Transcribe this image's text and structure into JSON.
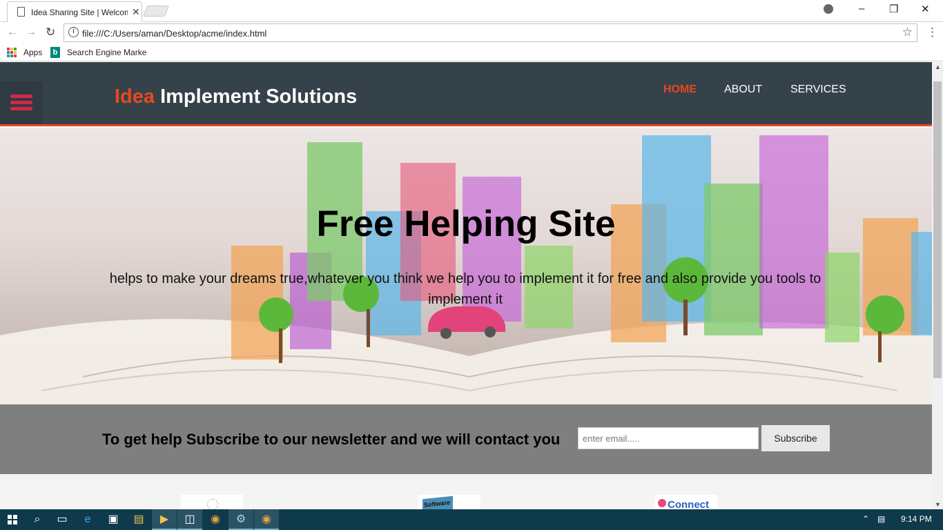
{
  "browser": {
    "tab_title": "Idea Sharing Site | Welcome",
    "tab_close": "✕",
    "url": "file:///C:/Users/aman/Desktop/acme/index.html",
    "bookmarks": [
      {
        "label": "Apps",
        "icon": "apps-grid-icon"
      },
      {
        "label": "Search Engine Marke",
        "icon": "bing-icon"
      }
    ],
    "window_controls": [
      "–",
      "❐",
      "✕"
    ]
  },
  "site": {
    "logo_highlight": "Idea",
    "logo_rest": " Implement Solutions",
    "nav": [
      {
        "label": "HOME",
        "active": true
      },
      {
        "label": "ABOUT",
        "active": false
      },
      {
        "label": "SERVICES",
        "active": false
      }
    ],
    "hero": {
      "title": "Free Helping Site",
      "subtitle": "helps to make your dreams true,whatever you think we help you to implement it for free and also provide you tools to implement it"
    },
    "newsletter": {
      "heading": "To get help Subscribe to our newsletter and we will contact you",
      "email_placeholder": "enter email.....",
      "button_label": "Subscribe"
    },
    "boxes": [
      {
        "label": "",
        "icon": "bulb-icon"
      },
      {
        "label": "Software",
        "icon": "software-box-icon"
      },
      {
        "label": "Connect",
        "icon": "connect-icon"
      }
    ],
    "colors": {
      "header_bg": "#35424a",
      "accent": "#e8491d",
      "hamburger": "#d6264b",
      "newsletter_bg": "#7f7f7f"
    }
  },
  "taskbar": {
    "time": "9:14 PM"
  }
}
